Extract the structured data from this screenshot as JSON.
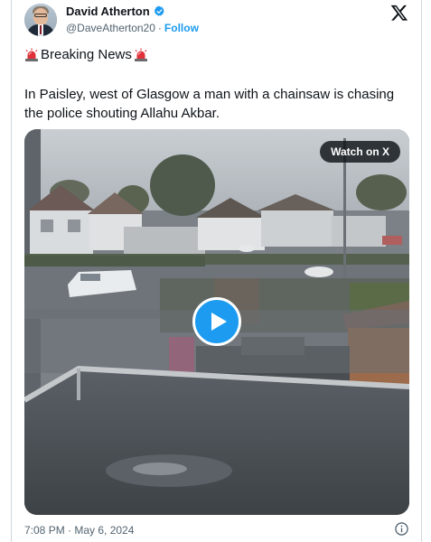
{
  "author": {
    "display_name": "David Atherton",
    "handle": "@DaveAtherton20",
    "separator": "·",
    "follow_label": "Follow",
    "verified_icon": "verified-badge-icon",
    "avatar": "avatar-photo"
  },
  "headline": {
    "text": "Breaking News",
    "emoji_icon": "police-siren-icon"
  },
  "body_text": "In Paisley, west of Glasgow a man with a chainsaw is chasing the police shouting Allahu Akbar.",
  "media": {
    "watch_label": "Watch on X",
    "play_icon": "play-icon"
  },
  "footer": {
    "timestamp": "7:08 PM · May 6, 2024",
    "info_icon": "info-icon"
  },
  "colors": {
    "accent": "#1d9bf0",
    "text_primary": "#0f1419",
    "text_secondary": "#536471",
    "siren_red": "#e0303a"
  }
}
